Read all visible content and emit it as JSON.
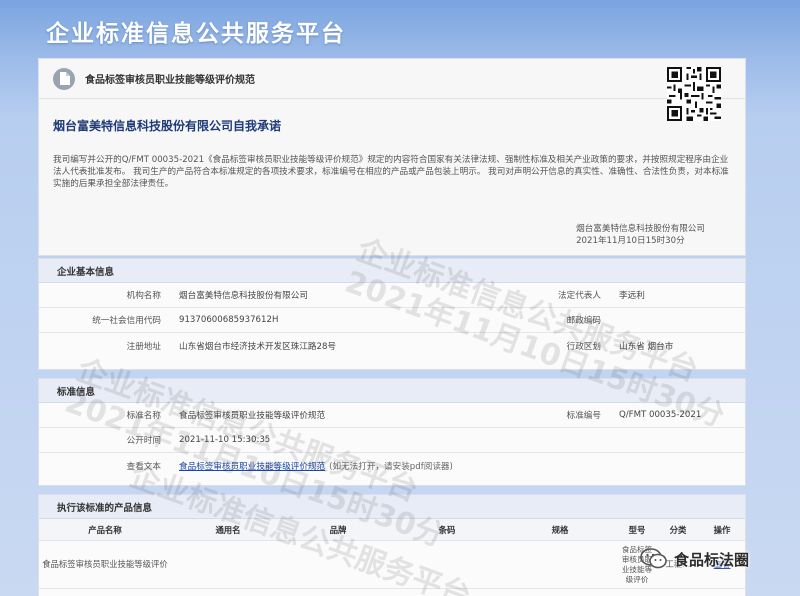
{
  "header": {
    "site_title": "企业标准信息公共服务平台"
  },
  "commitment": {
    "heading": "食品标签审核员职业技能等级评价规范",
    "title": "烟台富美特信息科技股份有限公司自我承诺",
    "body": "我司编写并公开的Q/FMT 00035-2021《食品标签审核员职业技能等级评价规范》规定的内容符合国家有关法律法规、强制性标准及相关产业政策的要求，并按照规定程序由企业法人代表批准发布。 我司生产的产品符合本标准规定的各项技术要求，标准编号在相应的产品或产品包装上明示。 我司对声明公开信息的真实性、准确性、合法性负责，对本标准实施的后果承担全部法律责任。",
    "signer": "烟台富美特信息科技股份有限公司",
    "date": "2021年11月10日15时30分"
  },
  "basic_info": {
    "section_title": "企业基本信息",
    "rows": [
      {
        "l1": "机构名称",
        "v1": "烟台富美特信息科技股份有限公司",
        "l2": "法定代表人",
        "v2": "李远利"
      },
      {
        "l1": "统一社会信用代码",
        "v1": "91370600685937612H",
        "l2": "邮政编码",
        "v2": ""
      },
      {
        "l1": "注册地址",
        "v1": "山东省烟台市经济技术开发区珠江路28号",
        "l2": "行政区划",
        "v2": "山东省 烟台市"
      }
    ]
  },
  "standard_info": {
    "section_title": "标准信息",
    "name_label": "标准名称",
    "name_value": "食品标签审核员职业技能等级评价规范",
    "code_label": "标准编号",
    "code_value": "Q/FMT 00035-2021",
    "time_label": "公开时间",
    "time_value": "2021-11-10 15:30:35",
    "text_label": "查看文本",
    "text_link": "食品标签审核员职业技能等级评价规范",
    "text_note": "(如无法打开，请安装pdf阅读器)"
  },
  "products": {
    "section_title": "执行该标准的产品信息",
    "columns": [
      "产品名称",
      "通用名",
      "品牌",
      "条码",
      "规格",
      "型号",
      "分类",
      "操作"
    ],
    "rows": [
      [
        "食品标签审核员职业技能等级评价",
        "",
        "",
        "",
        "",
        "食品标签审核员职业技能等级评价",
        "工程…",
        "查看"
      ]
    ]
  },
  "watermark": {
    "line1": "企业标准信息公共服务平台",
    "line2": "2021年11月10日15时30分"
  },
  "badge": {
    "text": "食品标法圈"
  }
}
